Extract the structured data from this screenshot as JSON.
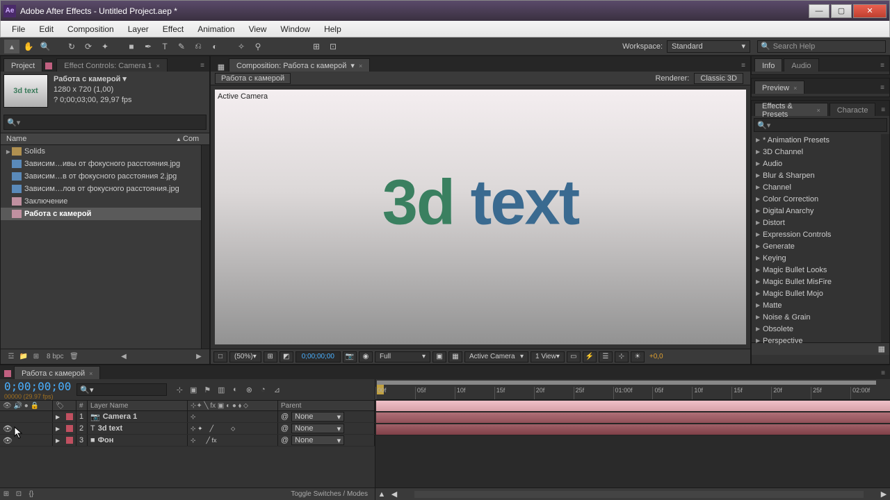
{
  "titlebar": {
    "title": "Adobe After Effects - Untitled Project.aep *",
    "app_icon": "Ae"
  },
  "menu": [
    "File",
    "Edit",
    "Composition",
    "Layer",
    "Effect",
    "Animation",
    "View",
    "Window",
    "Help"
  ],
  "toolbar": {
    "workspace_label": "Workspace:",
    "workspace_value": "Standard",
    "search_placeholder": "Search Help"
  },
  "project": {
    "tab": "Project",
    "fx_tab": "Effect Controls: Camera 1",
    "comp_name": "Работа с камерой ▾",
    "comp_dims": "1280 x 720 (1,00)",
    "comp_dur": "? 0;00;03;00, 29,97 fps",
    "thumb_text": "3d text",
    "header_name": "Name",
    "header_com": "Com",
    "items": [
      {
        "kind": "folder",
        "label": "Solids"
      },
      {
        "kind": "img",
        "label": "Зависим…ивы от фокусного расстояния.jpg"
      },
      {
        "kind": "img",
        "label": "Зависим…в от фокусного расстояния 2.jpg"
      },
      {
        "kind": "img",
        "label": "Зависим…лов от фокусного расстояния.jpg"
      },
      {
        "kind": "comp",
        "label": "Заключение"
      },
      {
        "kind": "comp",
        "label": "Работа с камерой",
        "sel": true
      }
    ],
    "bpc": "8 bpc"
  },
  "composition": {
    "tab_prefix": "Composition:",
    "tab_name": "Работа с камерой",
    "crumb": "Работа с камерой",
    "renderer_label": "Renderer:",
    "renderer_value": "Classic 3D",
    "active_camera": "Active Camera",
    "text_part1": "3d",
    "text_part2": "text",
    "footer": {
      "zoom": "(50%)",
      "time": "0;00;00;00",
      "res": "Full",
      "cam": "Active Camera",
      "views": "1 View",
      "exposure": "+0,0"
    }
  },
  "right_panels": {
    "info": "Info",
    "audio": "Audio",
    "preview": "Preview",
    "effects_presets": "Effects & Presets",
    "character": "Characte",
    "ep_items": [
      "* Animation Presets",
      "3D Channel",
      "Audio",
      "Blur & Sharpen",
      "Channel",
      "Color Correction",
      "Digital Anarchy",
      "Distort",
      "Expression Controls",
      "Generate",
      "Keying",
      "Magic Bullet Looks",
      "Magic Bullet MisFire",
      "Magic Bullet Mojo",
      "Matte",
      "Noise & Grain",
      "Obsolete",
      "Perspective"
    ]
  },
  "timeline": {
    "tab": "Работа с камерой",
    "time": "0;00;00;00",
    "time_sub": "00000 (29.97 fps)",
    "col_num": "#",
    "col_layer": "Layer Name",
    "col_parent": "Parent",
    "layers": [
      {
        "num": 1,
        "name": "Camera 1",
        "parent": "None",
        "icon": "cam"
      },
      {
        "num": 2,
        "name": "3d text",
        "parent": "None",
        "icon": "txt"
      },
      {
        "num": 3,
        "name": "Фон",
        "parent": "None",
        "icon": "bg"
      }
    ],
    "ruler": [
      "00f",
      "05f",
      "10f",
      "15f",
      "20f",
      "25f",
      "01:00f",
      "05f",
      "10f",
      "15f",
      "20f",
      "25f",
      "02:00f"
    ],
    "toggle_label": "Toggle Switches / Modes"
  }
}
